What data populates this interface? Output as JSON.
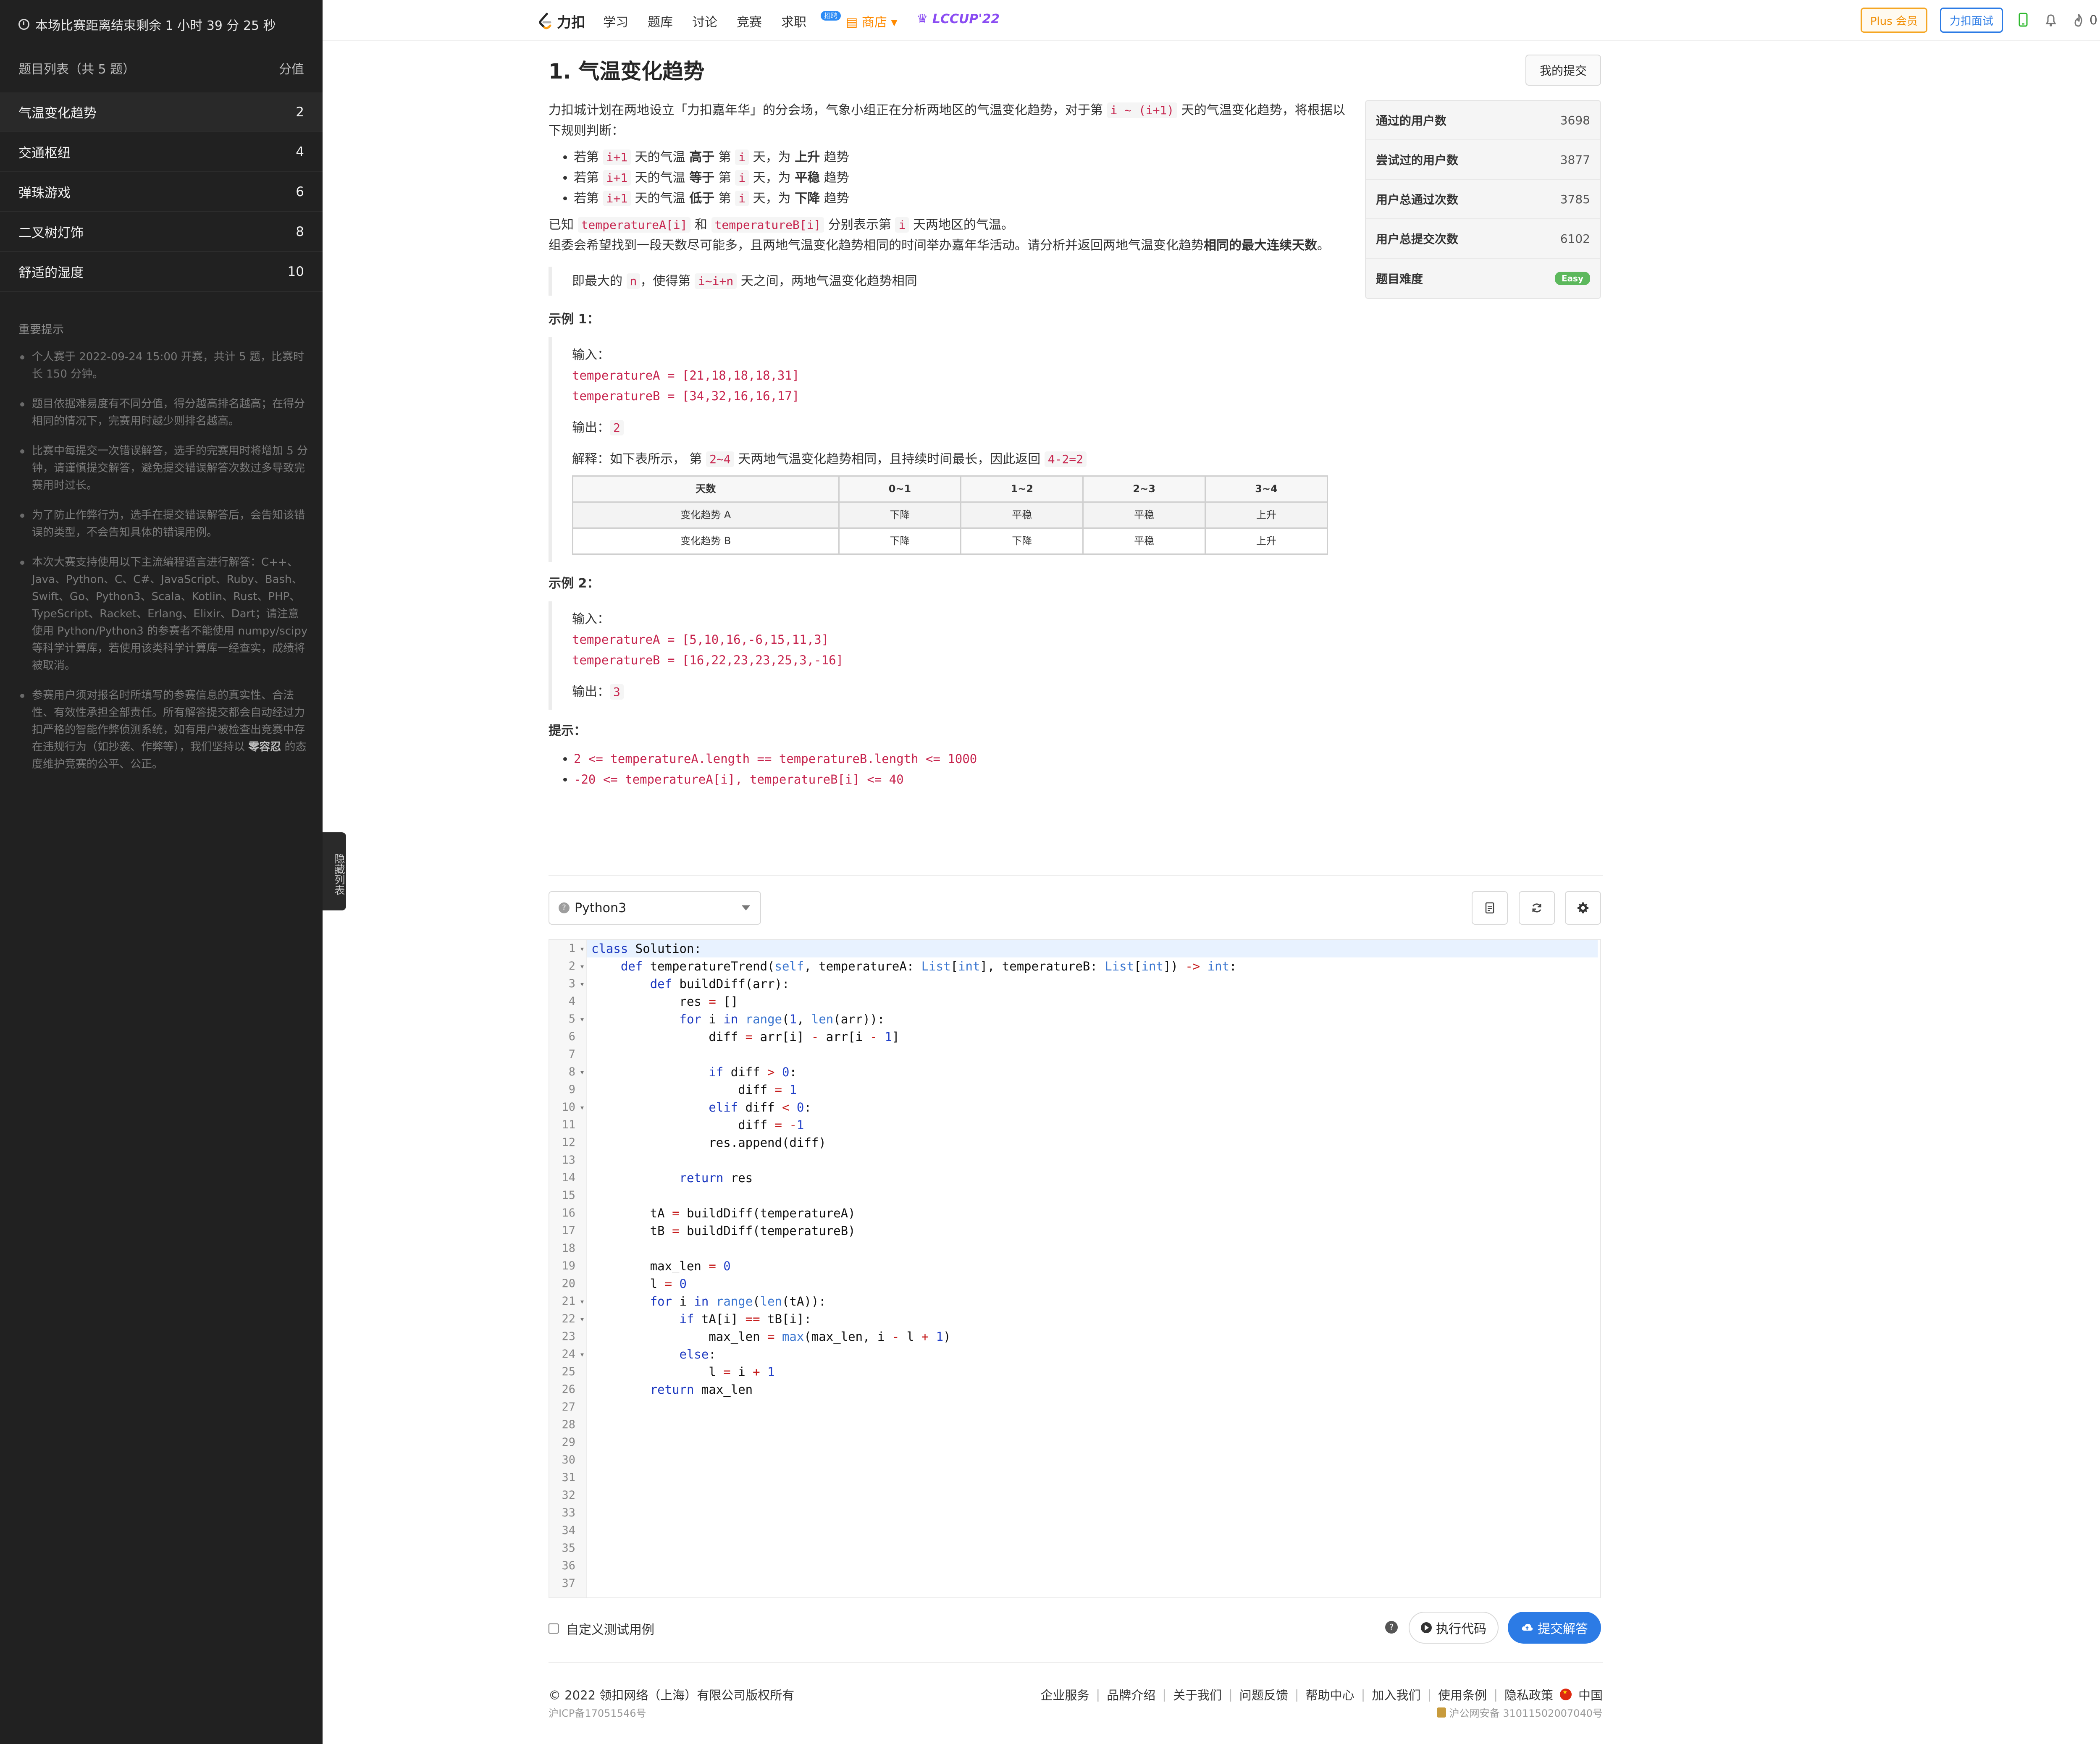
{
  "sidebar": {
    "timer": "本场比赛距离结束剩余 1 小时 39 分 25 秒",
    "list_header": "题目列表（共 5 题）",
    "score_header": "分值",
    "items": [
      {
        "label": "气温变化趋势",
        "score": "2"
      },
      {
        "label": "交通枢纽",
        "score": "4"
      },
      {
        "label": "弹珠游戏",
        "score": "6"
      },
      {
        "label": "二叉树灯饰",
        "score": "8"
      },
      {
        "label": "舒适的湿度",
        "score": "10"
      }
    ],
    "notes_title": "重要提示",
    "notes": [
      "个人赛于 2022-09-24 15:00 开赛，共计 5 题，比赛时长 150 分钟。",
      "题目依据难易度有不同分值，得分越高排名越高；在得分相同的情况下，完赛用时越少则排名越高。",
      "比赛中每提交一次错误解答，选手的完赛用时将增加 5 分钟，请谨慎提交解答，避免提交错误解答次数过多导致完赛用时过长。",
      "为了防止作弊行为，选手在提交错误解答后，会告知该错误的类型，不会告知具体的错误用例。",
      "本次大赛支持使用以下主流编程语言进行解答：C++、Java、Python、C、C#、JavaScript、Ruby、Bash、Swift、Go、Python3、Scala、Kotlin、Rust、PHP、TypeScript、Racket、Erlang、Elixir、Dart；请注意使用 Python/Python3 的参赛者不能使用 numpy/scipy 等科学计算库，若使用该类科学计算库一经查实，成绩将被取消。"
    ],
    "note6_a": "参赛用户须对报名时所填写的参赛信息的真实性、合法性、有效性承担全部责任。所有解答提交都会自动经过力扣严格的智能作弊侦测系统，如有用户被检查出竞赛中存在违规行为（如抄袭、作弊等），我们坚持以 ",
    "note6_b": "零容忍",
    "note6_c": " 的态度维护竞赛的公平、公正。",
    "hide_tab": "隐藏列表"
  },
  "topnav": {
    "logo": "力扣",
    "links": [
      "学习",
      "题库",
      "讨论",
      "竞赛",
      "求职",
      "商店"
    ],
    "job_badge": "招聘",
    "lccup": "LCCUP'22",
    "plus": "Plus 会员",
    "interview": "力扣面试",
    "fire_count": "0"
  },
  "problem": {
    "title": "1. 气温变化趋势",
    "my_submissions": "我的提交",
    "intro_a": "力扣城计划在两地设立「力扣嘉年华」的分会场，气象小组正在分析两地区的气温变化趋势，对于第 ",
    "intro_code": "i ~ (i+1)",
    "intro_b": " 天的气温变化趋势，将根据以下规则判断：",
    "rules": [
      {
        "a": "若第 ",
        "c1": "i+1",
        "b": " 天的气温 ",
        "bold": "高于",
        "c": " 第 ",
        "c2": "i",
        "d": " 天，为 ",
        "bold2": "上升",
        "e": " 趋势"
      },
      {
        "a": "若第 ",
        "c1": "i+1",
        "b": " 天的气温 ",
        "bold": "等于",
        "c": " 第 ",
        "c2": "i",
        "d": " 天，为 ",
        "bold2": "平稳",
        "e": " 趋势"
      },
      {
        "a": "若第 ",
        "c1": "i+1",
        "b": " 天的气温 ",
        "bold": "低于",
        "c": " 第 ",
        "c2": "i",
        "d": " 天，为 ",
        "bold2": "下降",
        "e": " 趋势"
      }
    ],
    "known_a": "已知 ",
    "known_c1": "temperatureA[i]",
    "known_b": " 和 ",
    "known_c2": "temperatureB[i]",
    "known_c": " 分别表示第 ",
    "known_c3": "i",
    "known_d": " 天两地区的气温。",
    "goal_a": "组委会希望找到一段天数尽可能多，且两地气温变化趋势相同的时间举办嘉年华活动。请分析并返回两地气温变化趋势",
    "goal_bold": "相同的最大连续天数",
    "goal_b": "。",
    "quote_a": "即最大的 ",
    "quote_c1": "n",
    "quote_b": "，使得第 ",
    "quote_c2": "i~i+n",
    "quote_c": " 天之间，两地气温变化趋势相同",
    "example1_title": "示例 1：",
    "ex1_input_label": "输入：",
    "ex1_input": "temperatureA = [21,18,18,18,31]\ntemperatureB = [34,32,16,16,17]",
    "ex1_output_label": "输出：",
    "ex1_output": "2",
    "ex1_explain_a": "解释：如下表所示， 第 ",
    "ex1_explain_c1": "2~4",
    "ex1_explain_b": " 天两地气温变化趋势相同，且持续时间最长，因此返回 ",
    "ex1_explain_c2": "4-2=2",
    "table_headers": [
      "天数",
      "0~1",
      "1~2",
      "2~3",
      "3~4"
    ],
    "table_rows": [
      [
        "变化趋势 A",
        "下降",
        "平稳",
        "平稳",
        "上升"
      ],
      [
        "变化趋势 B",
        "下降",
        "下降",
        "平稳",
        "上升"
      ]
    ],
    "example2_title": "示例 2：",
    "ex2_input_label": "输入：",
    "ex2_input": "temperatureA = [5,10,16,-6,15,11,3]\ntemperatureB = [16,22,23,23,25,3,-16]",
    "ex2_output_label": "输出：",
    "ex2_output": "3",
    "hints_title": "提示：",
    "constraints": [
      "2 <= temperatureA.length == temperatureB.length <= 1000",
      "-20 <= temperatureA[i], temperatureB[i] <= 40"
    ]
  },
  "stats": [
    {
      "label": "通过的用户数",
      "value": "3698"
    },
    {
      "label": "尝试过的用户数",
      "value": "3877"
    },
    {
      "label": "用户总通过次数",
      "value": "3785"
    },
    {
      "label": "用户总提交次数",
      "value": "6102"
    },
    {
      "label": "题目难度",
      "value": "Easy"
    }
  ],
  "editor": {
    "language": "Python3",
    "line_count": 37,
    "code_lines": [
      "class Solution:",
      "    def temperatureTrend(self, temperatureA: List[int], temperatureB: List[int]) -> int:",
      "        def buildDiff(arr):",
      "            res = []",
      "            for i in range(1, len(arr)):",
      "                diff = arr[i] - arr[i - 1]",
      "",
      "                if diff > 0:",
      "                    diff = 1",
      "                elif diff < 0:",
      "                    diff = -1",
      "                res.append(diff)",
      "",
      "            return res",
      "",
      "        tA = buildDiff(temperatureA)",
      "        tB = buildDiff(temperatureB)",
      "",
      "        max_len = 0",
      "        l = 0",
      "        for i in range(len(tA)):",
      "            if tA[i] == tB[i]:",
      "                max_len = max(max_len, i - l + 1)",
      "            else:",
      "                l = i + 1",
      "        return max_len"
    ],
    "custom_test": "自定义测试用例",
    "run": "执行代码",
    "submit": "提交解答"
  },
  "footer": {
    "copyright": "© 2022 领扣网络（上海）有限公司版权所有",
    "icp": "沪ICP备17051546号",
    "links": [
      "企业服务",
      "品牌介绍",
      "关于我们",
      "问题反馈",
      "帮助中心",
      "加入我们",
      "使用条例",
      "隐私政策"
    ],
    "region": "中国",
    "gongan": "沪公网安备 31011502007040号"
  }
}
